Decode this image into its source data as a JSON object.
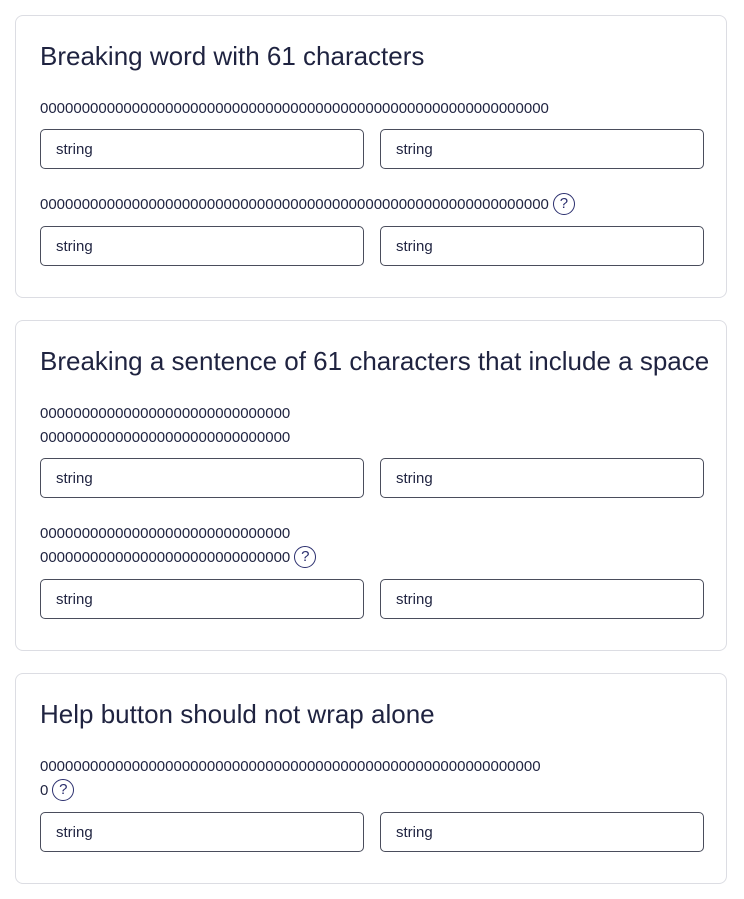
{
  "sections": [
    {
      "title": "Breaking word with 61 characters",
      "rows": [
        {
          "label": "0000000000000000000000000000000000000000000000000000000000000",
          "has_help": false,
          "field1": "string",
          "field2": "string"
        },
        {
          "label": "0000000000000000000000000000000000000000000000000000000000000",
          "has_help": true,
          "field1": "string",
          "field2": "string"
        }
      ]
    },
    {
      "title": "Breaking a sentence of 61 characters that include a space",
      "rows": [
        {
          "label_line1": "000000000000000000000000000000",
          "label_line2": "000000000000000000000000000000",
          "has_help": false,
          "field1": "string",
          "field2": "string"
        },
        {
          "label_line1": "000000000000000000000000000000",
          "label_line2": "000000000000000000000000000000",
          "has_help": true,
          "field1": "string",
          "field2": "string"
        }
      ]
    },
    {
      "title": "Help button should not wrap alone",
      "rows": [
        {
          "label_line1": "000000000000000000000000000000000000000000000000000000000000",
          "label_line2": "0",
          "has_help": true,
          "field1": "string",
          "field2": "string"
        }
      ]
    }
  ],
  "help_glyph": "?",
  "icons": {
    "help": "question-circle-icon"
  }
}
